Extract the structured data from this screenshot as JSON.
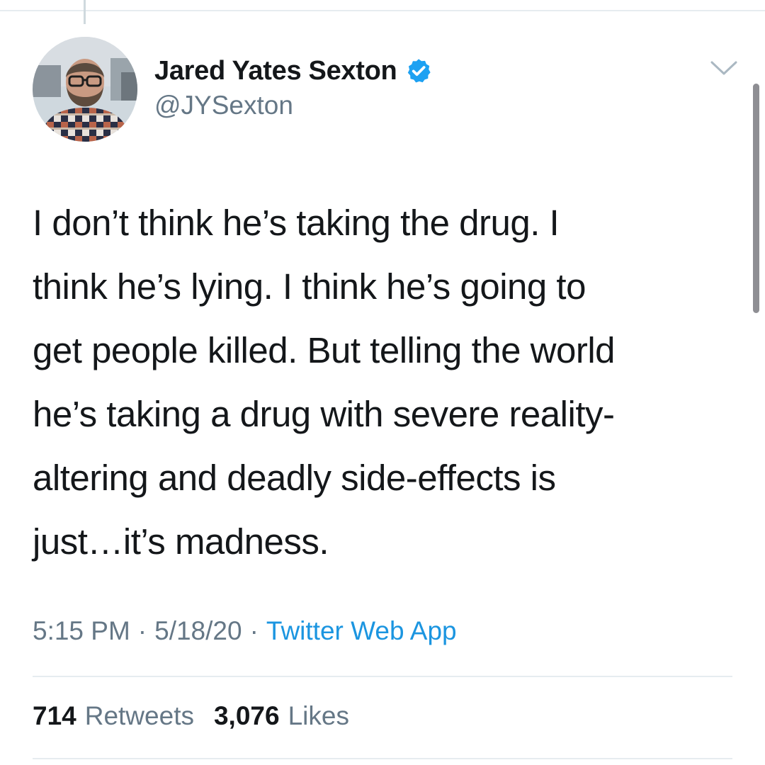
{
  "tweet": {
    "author": {
      "display_name": "Jared Yates Sexton",
      "handle": "@JYSexton",
      "verified": true,
      "avatar_icon": "avatar-photo"
    },
    "text_lines": [
      "I don’t think he’s taking the drug. I",
      "think he’s lying. I think he’s going to",
      "get people killed. But telling the world",
      "he’s taking a drug with severe reality-",
      "altering and deadly side-effects is",
      "just…it’s madness."
    ],
    "meta": {
      "time": "5:15 PM",
      "separator": "·",
      "date": "5/18/20",
      "source": "Twitter Web App"
    },
    "stats": {
      "retweets_count": "714",
      "retweets_label": "Retweets",
      "likes_count": "3,076",
      "likes_label": "Likes"
    }
  },
  "icons": {
    "verified": "verified-badge-icon",
    "more": "chevron-down-icon"
  },
  "colors": {
    "text_primary": "#14171a",
    "text_secondary": "#657786",
    "link": "#1b95e0",
    "verified_blue": "#1da1f2",
    "divider": "#e6ecf0"
  }
}
